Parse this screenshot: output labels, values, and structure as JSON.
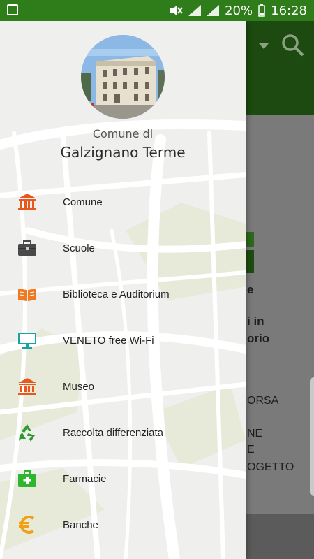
{
  "status_bar": {
    "battery": "20%",
    "time": "16:28"
  },
  "drawer": {
    "subtitle": "Comune di",
    "title": "Galzignano Terme",
    "items": [
      {
        "label": "Comune",
        "icon": "bank-icon",
        "color": "#e8581c"
      },
      {
        "label": "Scuole",
        "icon": "briefcase-icon",
        "color": "#4a4a4a"
      },
      {
        "label": "Biblioteca e Auditorium",
        "icon": "book-icon",
        "color": "#f07a22"
      },
      {
        "label": "VENETO free Wi-Fi",
        "icon": "monitor-icon",
        "color": "#17a2a8"
      },
      {
        "label": "Museo",
        "icon": "museum-icon",
        "color": "#e8581c"
      },
      {
        "label": "Raccolta differenziata",
        "icon": "recycle-icon",
        "color": "#2e9a2e"
      },
      {
        "label": "Farmacie",
        "icon": "first-aid-kit-icon",
        "color": "#2fb52f"
      },
      {
        "label": "Banche",
        "icon": "euro-icon",
        "color": "#f0a010"
      }
    ]
  },
  "background": {
    "texts": [
      "e",
      "i in",
      "orio",
      "ORSA",
      "NE",
      "E",
      "OGETTO"
    ]
  },
  "colors": {
    "status_bar": "#2f7d1a",
    "toolbar": "#1c4a10"
  }
}
